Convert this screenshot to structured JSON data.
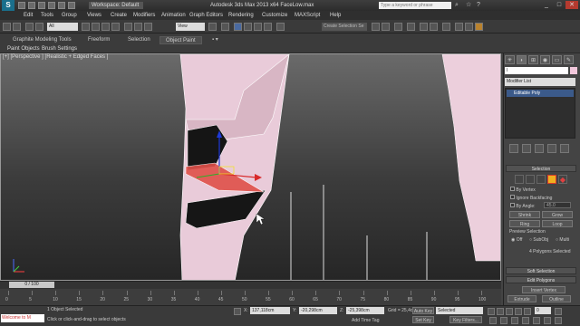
{
  "app": {
    "workspace": "Workspace: Default",
    "window_title": "Autodesk 3ds Max 2013 x64      FaceLow.max",
    "search_placeholder": "Type a keyword or phrase"
  },
  "menu": [
    "Edit",
    "Tools",
    "Group",
    "Views",
    "Create",
    "Modifiers",
    "Animation",
    "Graph Editors",
    "Rendering",
    "Customize",
    "MAXScript",
    "Help"
  ],
  "toolbar": {
    "filter_dropdown": "All",
    "view_dropdown": "View",
    "named_selection": "Create Selection Se"
  },
  "ribbon": {
    "tabs": [
      "Graphite Modeling Tools",
      "Freeform",
      "Selection",
      "Object Paint"
    ],
    "active_tab": "Object Paint",
    "subtabs": [
      "Paint Objects",
      "Brush Settings"
    ]
  },
  "viewport": {
    "label": "[+] [Perspective ] [Realistic + Edged Faces ]"
  },
  "command_panel": {
    "object_name": "l",
    "object_color": "#f2c8dc",
    "modifier_list": "Modifier List",
    "stack_item": "Editable Poly",
    "selection_rollout": "Selection",
    "by_vertex": "By Vertex",
    "ignore_backfacing": "Ignore Backfacing",
    "by_angle": "By Angle:",
    "by_angle_value": "45.0",
    "shrink": "Shrink",
    "grow": "Grow",
    "ring": "Ring",
    "loop": "Loop",
    "preview_selection": "Preview Selection",
    "preview_off": "Off",
    "preview_subobj": "SubObj",
    "preview_multi": "Multi",
    "selection_status": "4 Polygons Selected",
    "soft_selection": "Soft Selection",
    "edit_polygons": "Edit Polygons",
    "insert_vertex": "Insert Vertex",
    "extrude": "Extrude",
    "outline": "Outline"
  },
  "timeline": {
    "frame_display": "0 / 100",
    "ticks": [
      "0",
      "5",
      "10",
      "15",
      "20",
      "25",
      "30",
      "35",
      "40",
      "45",
      "50",
      "55",
      "60",
      "65",
      "70",
      "75",
      "80",
      "85",
      "90",
      "95",
      "100"
    ]
  },
  "status": {
    "maxscript": "Welcome to M",
    "selection_count": "1 Object Selected",
    "prompt": "Click or click-and-drag to select objects",
    "x_label": "X:",
    "x_value": "137,118cm",
    "y_label": "Y:",
    "y_value": "-20,298cm",
    "z_label": "Z:",
    "z_value": "-25,398cm",
    "grid": "Grid = 25,4cm",
    "auto_key": "Auto Key",
    "set_key": "Set Key",
    "key_mode": "Selected",
    "key_filters": "Key Filters...",
    "add_time_tag": "Add Time Tag",
    "current_frame": "0"
  },
  "colors": {
    "accent": "#3b5a8a",
    "mesh": "#f2c8dc",
    "selected_face": "#e0504a"
  }
}
